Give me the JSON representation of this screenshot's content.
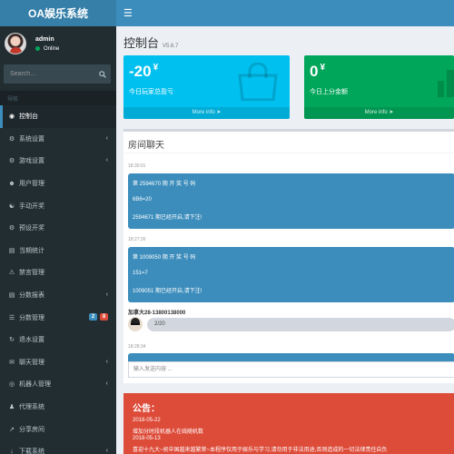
{
  "app": {
    "title": "OA娱乐系统"
  },
  "header": {
    "menu_icon": "hamburger-icon"
  },
  "user": {
    "name": "admin",
    "status": "Online"
  },
  "search": {
    "placeholder": "Search..."
  },
  "sidebar": {
    "nav_header": "导航",
    "items": [
      {
        "label": "控制台",
        "icon": "dashboard-icon",
        "active": true,
        "chevron": false
      },
      {
        "label": "系统设置",
        "icon": "cogs-icon",
        "chevron": true
      },
      {
        "label": "游戏设置",
        "icon": "gamepad-icon",
        "chevron": true
      },
      {
        "label": "用户管理",
        "icon": "users-icon",
        "chevron": false
      },
      {
        "label": "手动开奖",
        "icon": "handshake-icon",
        "chevron": false
      },
      {
        "label": "预设开奖",
        "icon": "gear-icon",
        "chevron": false
      },
      {
        "label": "当期统计",
        "icon": "bar-chart-icon",
        "chevron": false
      },
      {
        "label": "禁言管理",
        "icon": "warning-icon",
        "chevron": false
      },
      {
        "label": "分数报表",
        "icon": "table-icon",
        "chevron": true
      },
      {
        "label": "分数管理",
        "icon": "list-icon",
        "chevron": false,
        "badges": [
          {
            "value": "2",
            "color": "#3c8dbc"
          },
          {
            "value": "8",
            "color": "#dd4b39"
          }
        ]
      },
      {
        "label": "退水设置",
        "icon": "refresh-icon",
        "chevron": false
      },
      {
        "label": "聊天管理",
        "icon": "chat-icon",
        "chevron": true
      },
      {
        "label": "机器人管理",
        "icon": "robot-icon",
        "chevron": true
      },
      {
        "label": "代理系统",
        "icon": "agent-icon",
        "chevron": false
      },
      {
        "label": "分享房间",
        "icon": "share-icon",
        "chevron": false
      },
      {
        "label": "下载系统",
        "icon": "download-icon",
        "chevron": true
      }
    ]
  },
  "page": {
    "title": "控制台",
    "version": "V5.6.7"
  },
  "stats": [
    {
      "value": "-20",
      "unit": "¥",
      "label": "今日玩家总盈亏",
      "footer": "More info",
      "color": "#00c0ef",
      "icon": "shopping-bag-icon"
    },
    {
      "value": "0",
      "unit": "¥",
      "label": "今日上分金额",
      "footer": "More info",
      "color": "#00a65a",
      "icon": "bar-chart-icon"
    }
  ],
  "chat": {
    "title": "房间聊天",
    "messages": [
      {
        "time": "18:30:01",
        "lines": [
          "第 2594670 期 开 奖 号 码",
          "6B6=20",
          "2594671 期已经开启,请下注!"
        ]
      },
      {
        "time": "18:27:26",
        "lines": [
          "第 1009050 期 开 奖 号 码",
          "151=7",
          "1009051 期已经开启,请下注!"
        ]
      },
      {
        "time": "18:28:34",
        "lines": []
      }
    ],
    "user_message": {
      "user": "加拿大28-13800138000",
      "text": "2/20"
    },
    "input_placeholder": "输入发送内容 ..."
  },
  "notice": {
    "title": "公告：",
    "lines": [
      "2018-05-22",
      "增加分时段机器人在线随机数",
      "2018-05-13",
      "喜迎十九大~祝中国越来越繁荣~本程序仅用于娱乐与学习,请勿用于非法用途,否则造成的一切法律责任自负"
    ]
  }
}
